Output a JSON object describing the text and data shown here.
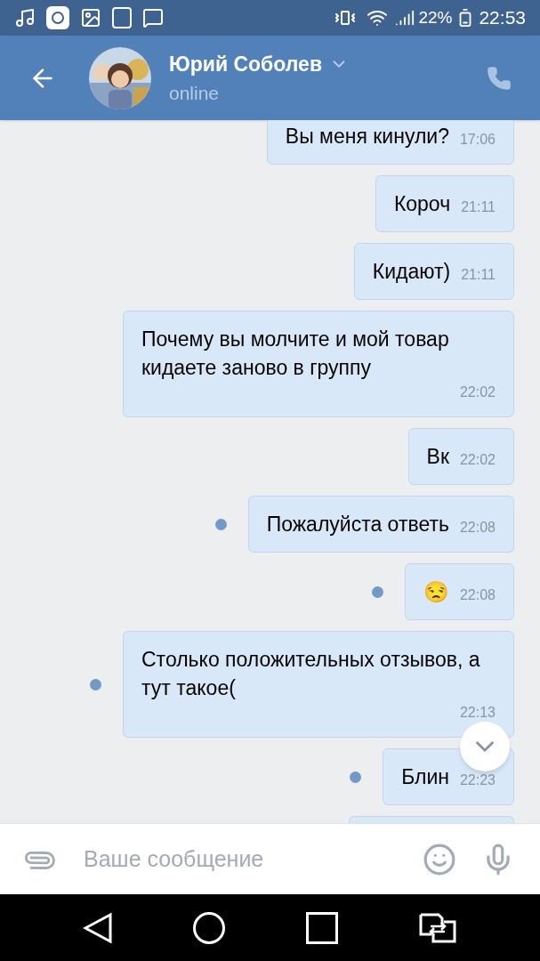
{
  "status_bar": {
    "battery": "22%",
    "time": "22:53"
  },
  "header": {
    "name": "Юрий Соболев",
    "status": "online"
  },
  "messages": [
    {
      "text": "Вы меня кинули?",
      "time": "17:06",
      "unread": false
    },
    {
      "text": "Короч",
      "time": "21:11",
      "unread": false
    },
    {
      "text": "Кидают)",
      "time": "21:11",
      "unread": false
    },
    {
      "text": "Почему вы молчите и мой товар кидаете заново в группу",
      "time": "22:02",
      "unread": false
    },
    {
      "text": "Вк",
      "time": "22:02",
      "unread": false
    },
    {
      "text": "Пожалуйста ответь",
      "time": "22:08",
      "unread": true
    },
    {
      "text": "😒",
      "time": "22:08",
      "unread": true
    },
    {
      "text": "Столько положительных отзывов, а тут такое(",
      "time": "22:13",
      "unread": true
    },
    {
      "text": "Блин",
      "time": "22:23",
      "unread": true
    }
  ],
  "composer": {
    "placeholder": "Ваше сообщение"
  }
}
